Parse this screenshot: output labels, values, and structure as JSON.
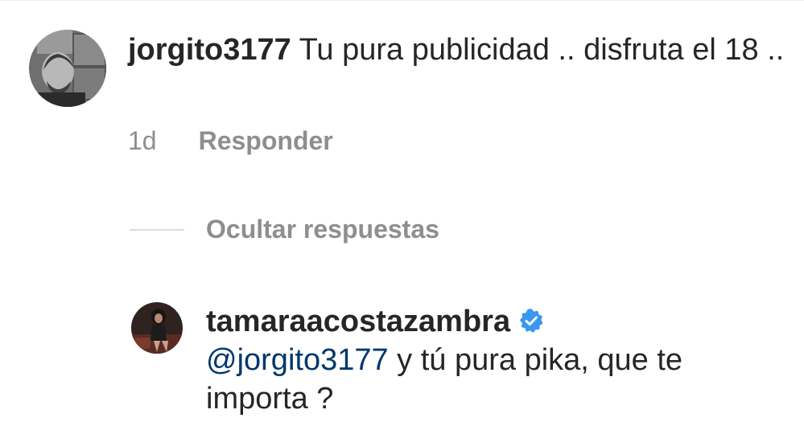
{
  "comment": {
    "username": "jorgito3177",
    "text": " Tu pura publicidad .. disfruta el 18 ..",
    "time": "1d",
    "reply_label": "Responder"
  },
  "replies_toggle": {
    "label": "Ocultar respuestas"
  },
  "reply": {
    "username": "tamaraacostazambra",
    "verified": true,
    "mention": "@jorgito3177",
    "text": " y tú pura pika, que te importa ?"
  },
  "colors": {
    "text": "#262626",
    "muted": "#8e8e8e",
    "mention": "#00376b",
    "verified": "#3897f0"
  }
}
